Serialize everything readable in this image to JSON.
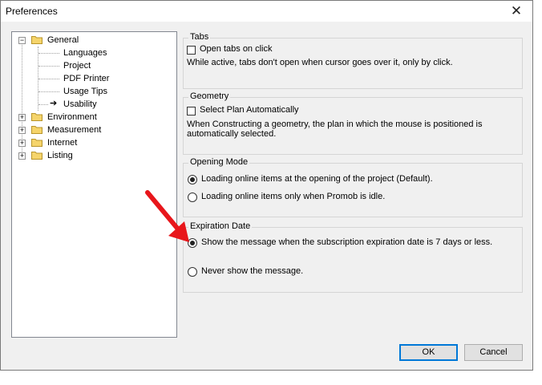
{
  "window": {
    "title": "Preferences"
  },
  "tree": {
    "general": "General",
    "children": [
      "Languages",
      "Project",
      "PDF Printer",
      "Usage Tips",
      "Usability"
    ],
    "selected": "Usability",
    "roots": [
      "Environment",
      "Measurement",
      "Internet",
      "Listing"
    ]
  },
  "tabs": {
    "legend": "Tabs",
    "checkbox": "Open tabs on click",
    "description": "While active, tabs don't open when cursor goes over it, only by click."
  },
  "geometry": {
    "legend": "Geometry",
    "checkbox": "Select Plan Automatically",
    "description_line1": "When Constructing a geometry, the plan in which the mouse is positioned is",
    "description_line2": "automatically selected."
  },
  "opening_mode": {
    "legend": "Opening Mode",
    "option1": "Loading online items at the opening of the project (Default).",
    "option2": "Loading online items only when Promob is idle."
  },
  "expiration_date": {
    "legend": "Expiration Date",
    "option1": "Show the message when the subscription expiration date is 7 days or less.",
    "option2": "Never show the message."
  },
  "buttons": {
    "ok": "OK",
    "cancel": "Cancel"
  },
  "colors": {
    "annotation_arrow": "#e8161b",
    "folder": "#f5d46b"
  }
}
